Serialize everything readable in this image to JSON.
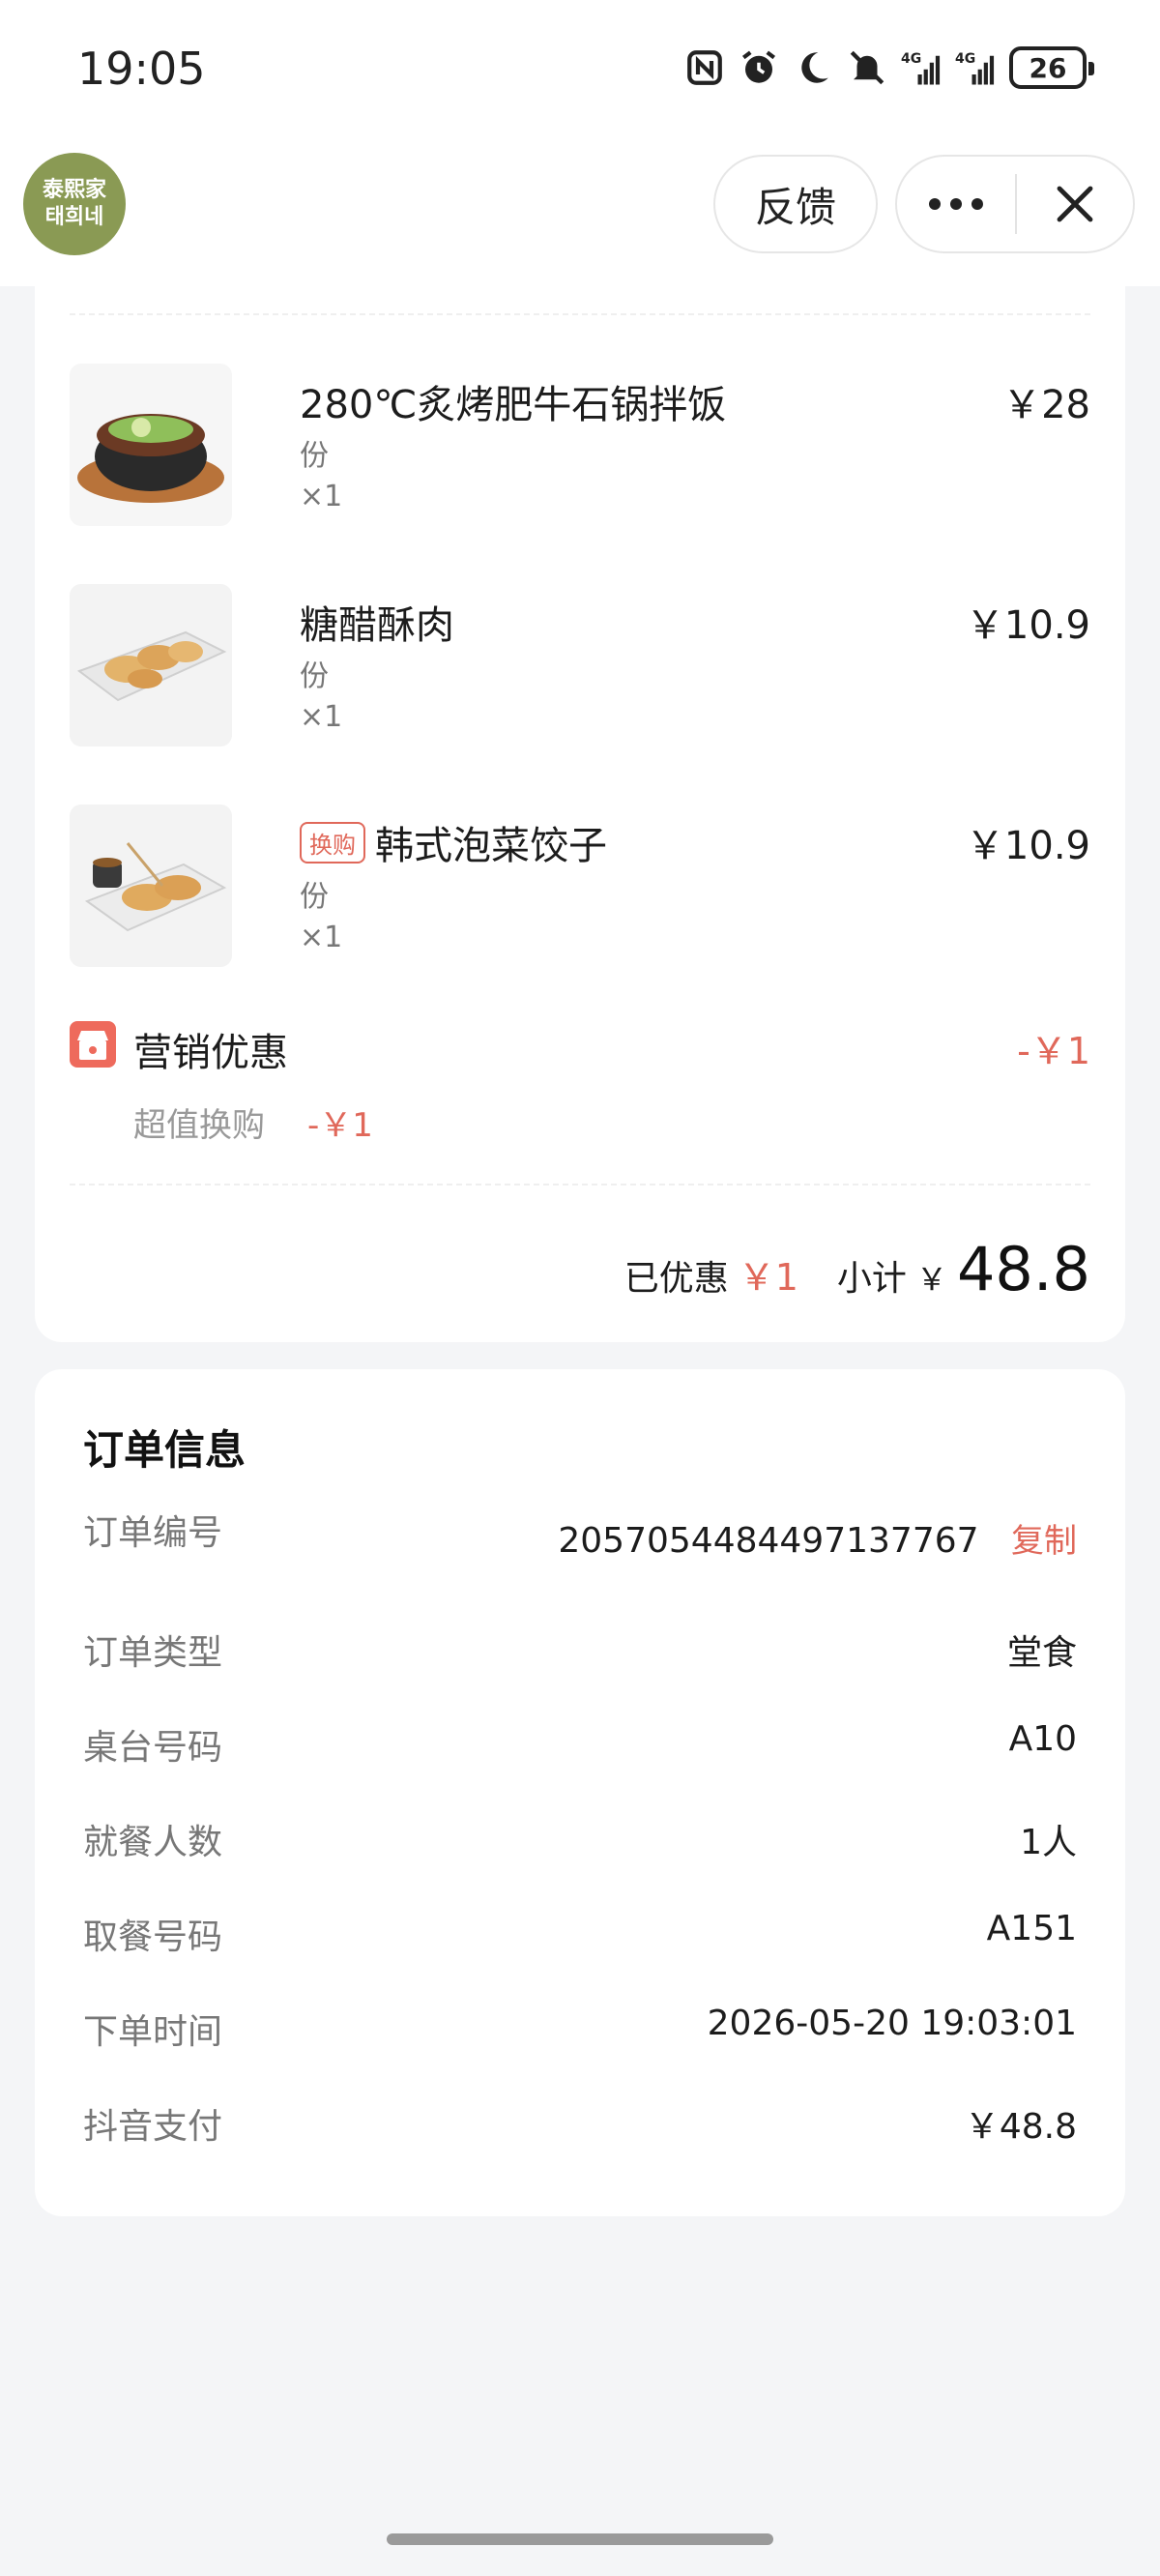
{
  "status_bar": {
    "time": "19:05",
    "battery": "26"
  },
  "header": {
    "logo_line1": "泰熙家",
    "logo_line2": "태희네",
    "feedback_label": "反馈"
  },
  "items": [
    {
      "name": "280℃炙烤肥牛石锅拌饭",
      "unit": "份",
      "qty": "×1",
      "price": "￥28",
      "tag": ""
    },
    {
      "name": "糖醋酥肉",
      "unit": "份",
      "qty": "×1",
      "price": "￥10.9",
      "tag": ""
    },
    {
      "name": "韩式泡菜饺子",
      "unit": "份",
      "qty": "×1",
      "price": "￥10.9",
      "tag": "换购"
    }
  ],
  "promo": {
    "title": "营销优惠",
    "amount": "-￥1",
    "sub_label": "超值换购",
    "sub_amount": "-￥1"
  },
  "summary": {
    "discount_label": "已优惠",
    "discount_value": "￥1",
    "subtotal_label": "小计",
    "currency": "￥",
    "subtotal_value": "48.8"
  },
  "order_info": {
    "title": "订单信息",
    "copy_label": "复制",
    "rows": [
      {
        "label": "订单编号",
        "value": "2057054484497137767"
      },
      {
        "label": "订单类型",
        "value": "堂食"
      },
      {
        "label": "桌台号码",
        "value": "A10"
      },
      {
        "label": "就餐人数",
        "value": "1人"
      },
      {
        "label": "取餐号码",
        "value": "A151"
      },
      {
        "label": "下单时间",
        "value": "2026-05-20 19:03:01"
      },
      {
        "label": "抖音支付",
        "value": "￥48.8"
      }
    ]
  },
  "colors": {
    "accent_red": "#e0685a",
    "logo_green": "#8a9a54"
  }
}
